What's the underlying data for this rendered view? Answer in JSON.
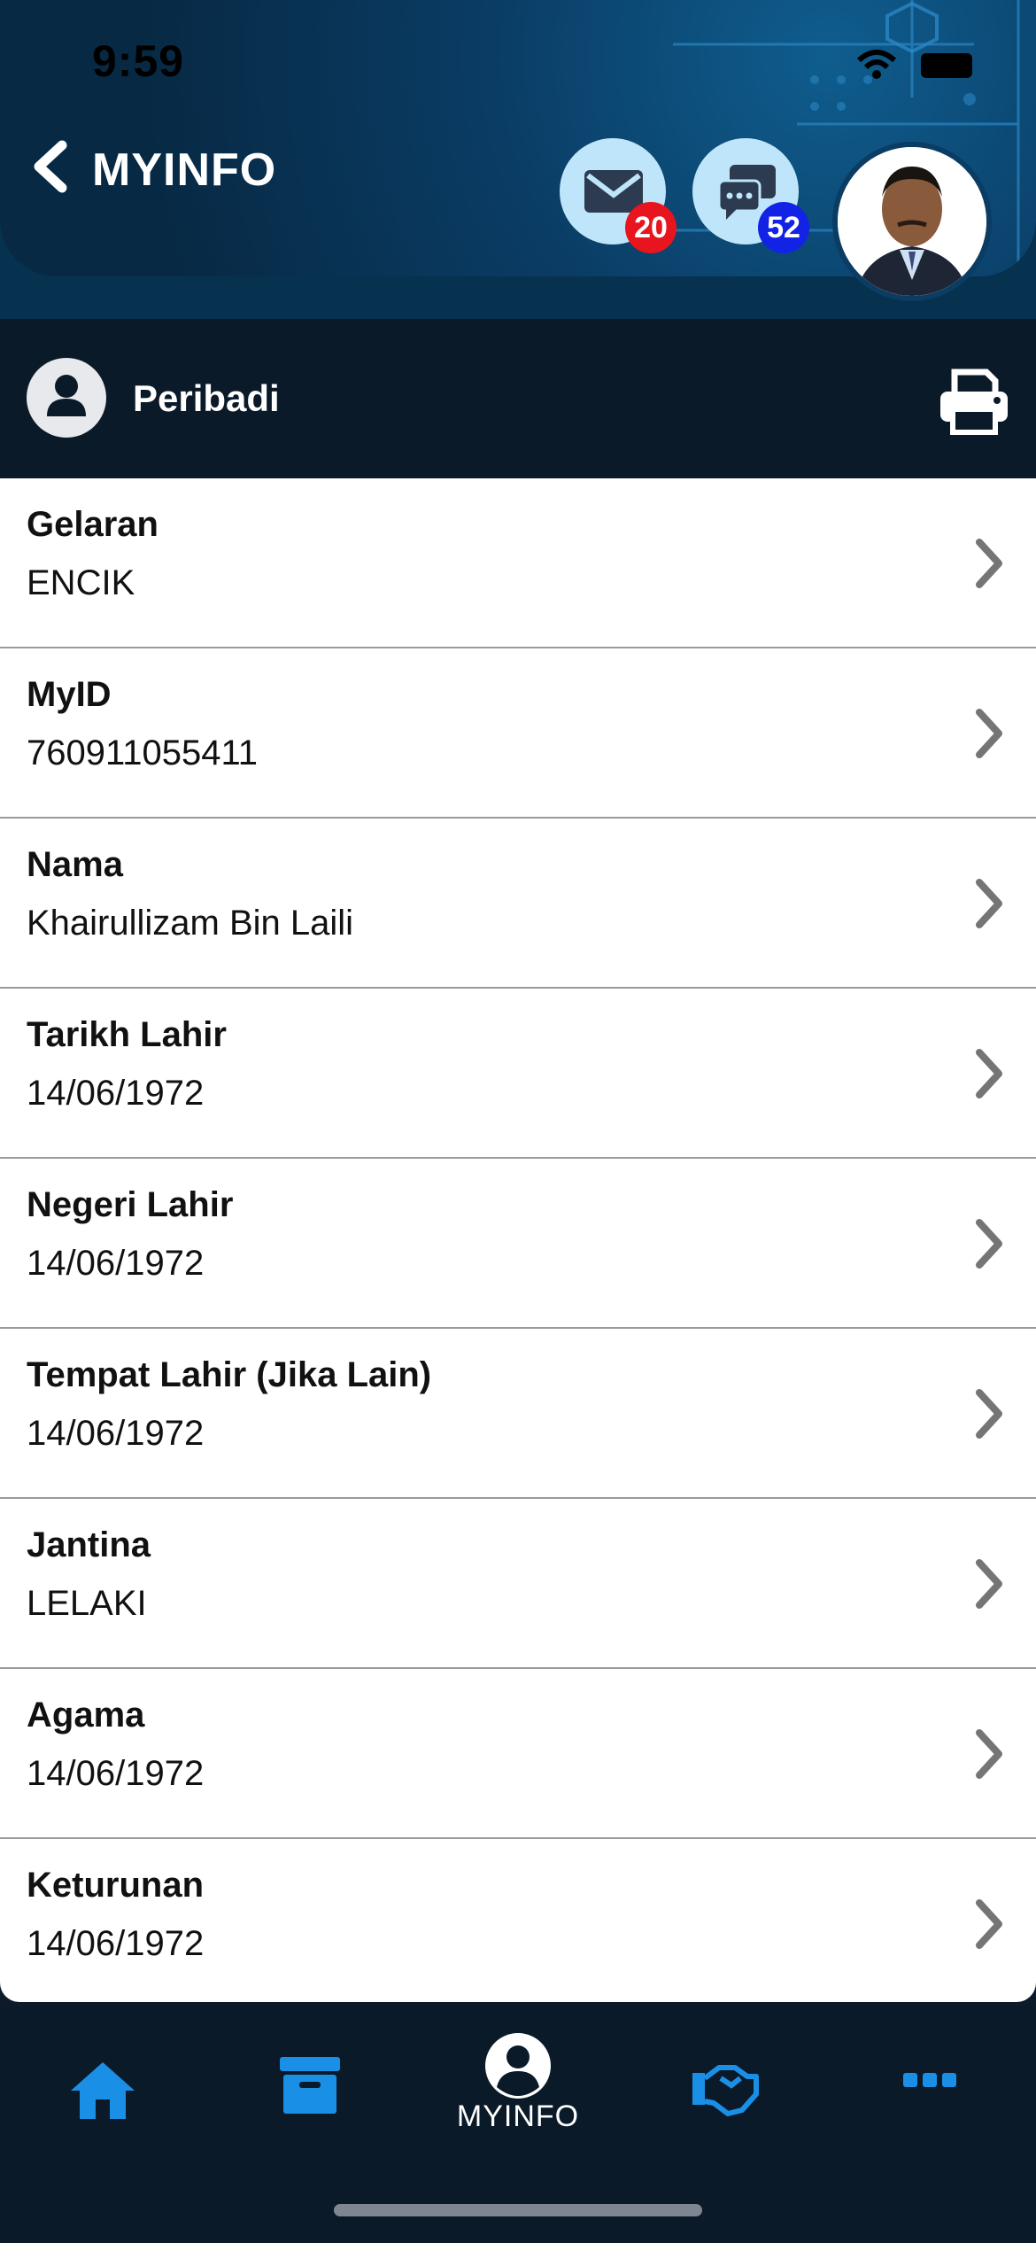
{
  "status_bar": {
    "time": "9:59"
  },
  "header": {
    "title": "MYINFO"
  },
  "badges": {
    "mail_count": "20",
    "chat_count": "52"
  },
  "section": {
    "label": "Peribadi"
  },
  "fields": [
    {
      "label": "Gelaran",
      "value": "ENCIK"
    },
    {
      "label": "MyID",
      "value": "760911055411"
    },
    {
      "label": "Nama",
      "value": "Khairullizam Bin Laili"
    },
    {
      "label": "Tarikh Lahir",
      "value": "14/06/1972"
    },
    {
      "label": "Negeri Lahir",
      "value": "14/06/1972"
    },
    {
      "label": "Tempat Lahir (Jika Lain)",
      "value": "14/06/1972"
    },
    {
      "label": "Jantina",
      "value": "LELAKI"
    },
    {
      "label": "Agama",
      "value": "14/06/1972"
    },
    {
      "label": "Keturunan",
      "value": "14/06/1972"
    }
  ],
  "tabbar": {
    "active_label": "MYINFO"
  },
  "colors": {
    "accent": "#1a8fe6",
    "header_dark": "#0b1a29",
    "badge_red": "#e8151f",
    "badge_blue": "#1223e6"
  }
}
